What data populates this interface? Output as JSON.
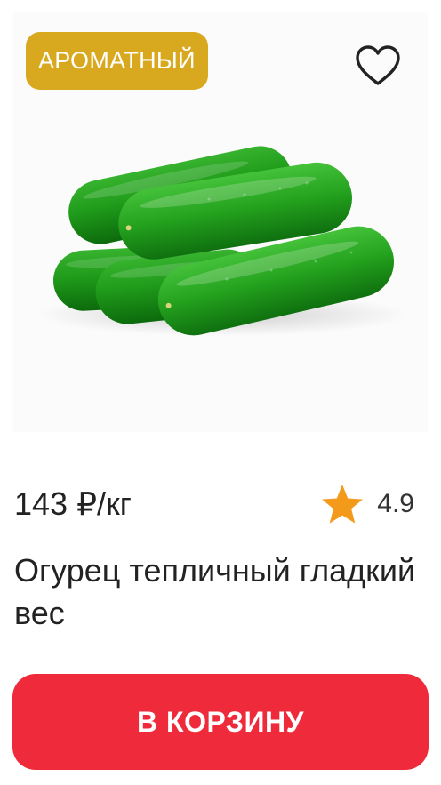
{
  "product": {
    "badge": "АРОМАТНЫЙ",
    "price": "143 ₽/кг",
    "rating": "4.9",
    "title": "Огурец тепличный гладкий вес",
    "image_subject": "cucumbers"
  },
  "actions": {
    "add_to_cart_label": "В КОРЗИНУ"
  },
  "icons": {
    "favorite": "heart-outline-icon",
    "rating": "star-icon"
  },
  "colors": {
    "badge_bg": "#D8A81E",
    "badge_text": "#ffffff",
    "star": "#F49A1B",
    "cart_button": "#EF2B3B",
    "heart_stroke": "#222222"
  }
}
